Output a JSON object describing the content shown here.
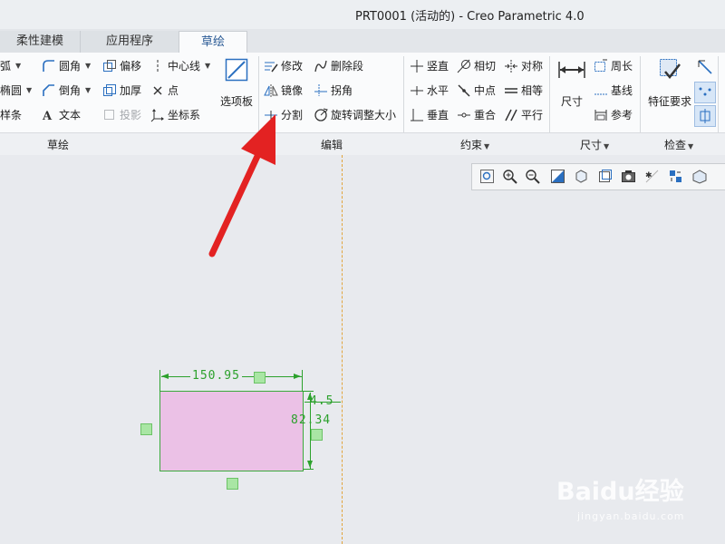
{
  "window": {
    "title": "PRT0001 (活动的) - Creo Parametric 4.0"
  },
  "tabs": [
    {
      "label": "柔性建模"
    },
    {
      "label": "应用程序"
    },
    {
      "label": "草绘"
    }
  ],
  "ribbon": {
    "sketch": {
      "group_label": "草绘",
      "arc_label": "弧",
      "ellipse_label": "椭圆",
      "spline_label": "样条",
      "fillet_label": "圆角",
      "chamfer_label": "倒角",
      "text_label": "文本",
      "offset_label": "偏移",
      "thicken_label": "加厚",
      "project_label": "投影",
      "centerline_label": "中心线",
      "point_label": "点",
      "coordsys_label": "坐标系",
      "palette_label": "选项板"
    },
    "edit": {
      "group_label": "编辑",
      "modify_label": "修改",
      "mirror_label": "镜像",
      "divide_label": "分割",
      "delete_segment_label": "删除段",
      "corner_label": "拐角",
      "rotate_resize_label": "旋转调整大小"
    },
    "constrain": {
      "group_label": "约束",
      "vertical_label": "竖直",
      "horizontal_label": "水平",
      "perpendicular_label": "垂直",
      "tangent_label": "相切",
      "midpoint_label": "中点",
      "coincident_label": "重合",
      "symmetric_label": "对称",
      "equal_label": "相等",
      "parallel_label": "平行"
    },
    "dimension": {
      "group_label": "尺寸",
      "dimension_label": "尺寸",
      "perimeter_label": "周长",
      "baseline_label": "基线",
      "reference_label": "参考"
    },
    "inspect": {
      "group_label": "检查",
      "feature_req_label": "特征要求"
    }
  },
  "sketch": {
    "width_dim": "150.95",
    "height_dim": "82.34",
    "offset_dim": "4.5"
  },
  "watermark": {
    "logo": "Baidu经验",
    "url": "jingyan.baidu.com"
  },
  "colors": {
    "rectangle_fill": "#ebc1e6",
    "sketch_green": "#2ca12c",
    "centerline": "#e2a43a",
    "arrow": "#e32222",
    "active_tab_text": "#2a5a95"
  },
  "icons": [
    "arc-icon",
    "ellipse-icon",
    "spline-icon",
    "fillet-icon",
    "chamfer-icon",
    "text-icon",
    "offset-icon",
    "thicken-icon",
    "project-icon",
    "centerline-icon",
    "point-icon",
    "coordsys-icon",
    "palette-icon",
    "modify-icon",
    "mirror-icon",
    "divide-icon",
    "delete-segment-icon",
    "corner-icon",
    "rotate-resize-icon",
    "vertical-icon",
    "horizontal-icon",
    "perpendicular-icon",
    "tangent-icon",
    "midpoint-icon",
    "coincident-icon",
    "symmetric-icon",
    "equal-icon",
    "parallel-icon",
    "dimension-icon",
    "perimeter-icon",
    "baseline-icon",
    "reference-icon",
    "feature-requirements-icon",
    "red-arrow"
  ]
}
